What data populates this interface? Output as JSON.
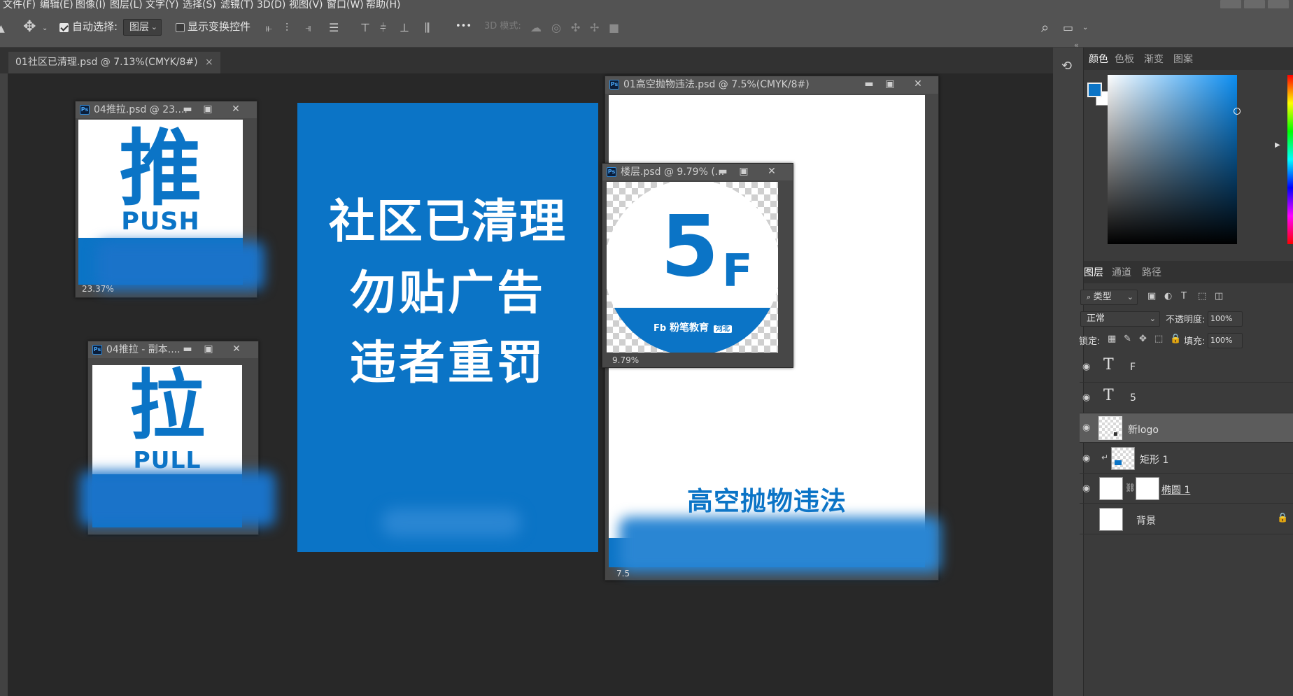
{
  "menu": [
    "文件(F)",
    "编辑(E)",
    "图像(I)",
    "图层(L)",
    "文字(Y)",
    "选择(S)",
    "滤镜(T)",
    "3D(D)",
    "视图(V)",
    "窗口(W)",
    "帮助(H)"
  ],
  "options": {
    "auto_select_label": "自动选择:",
    "auto_select_value": "图层",
    "show_transform_label": "显示变换控件",
    "more": "•••",
    "mode_3d_label": "3D 模式:"
  },
  "main_tab": {
    "title": "01社区已清理.psd @ 7.13%(CMYK/8#)",
    "close": "×"
  },
  "main_canvas": {
    "lines": [
      "社区已清理",
      "勿贴广告",
      "违者重罚"
    ]
  },
  "win_push": {
    "title": "04推拉.psd @ 23....",
    "big_char": "推",
    "sub": "PUSH",
    "zoom": "23.37%"
  },
  "win_pull": {
    "title": "04推拉 - 副本....",
    "big_char": "拉",
    "sub": "PULL"
  },
  "win_high": {
    "title": "01高空抛物违法.psd @ 7.5%(CMYK/8#)",
    "caption": "高空抛物违法",
    "zoom": "7.5"
  },
  "win_floor": {
    "title": "楼层.psd @ 9.79% (...",
    "big": "5",
    "small": "F",
    "logo_text": "粉笔教育",
    "logo_badge": "河北",
    "zoom": "9.79%"
  },
  "window_controls": {
    "minimize": "▬",
    "maximize": "▣",
    "close": "✕"
  },
  "right_tabs_top": [
    "颜色",
    "色板",
    "渐变",
    "图案"
  ],
  "right_tabs_layers": [
    "图层",
    "通道",
    "路径"
  ],
  "layers_panel": {
    "filter_label": "类型",
    "blend_mode": "正常",
    "opacity_label": "不透明度:",
    "opacity_value": "100%",
    "lock_label": "锁定:",
    "fill_label": "填充:",
    "fill_value": "100%"
  },
  "layers": [
    {
      "name": "F",
      "kind": "text",
      "selected": false
    },
    {
      "name": "5",
      "kind": "text",
      "selected": false
    },
    {
      "name": "新logo",
      "kind": "smart",
      "selected": true
    },
    {
      "name": "矩形 1",
      "kind": "shape",
      "selected": false
    },
    {
      "name": "椭圆 1",
      "kind": "shape-mask",
      "selected": false
    },
    {
      "name": "背景",
      "kind": "background",
      "selected": false
    }
  ],
  "colors": {
    "accent_blue": "#0b74c6",
    "ui_gray": "#535353"
  }
}
